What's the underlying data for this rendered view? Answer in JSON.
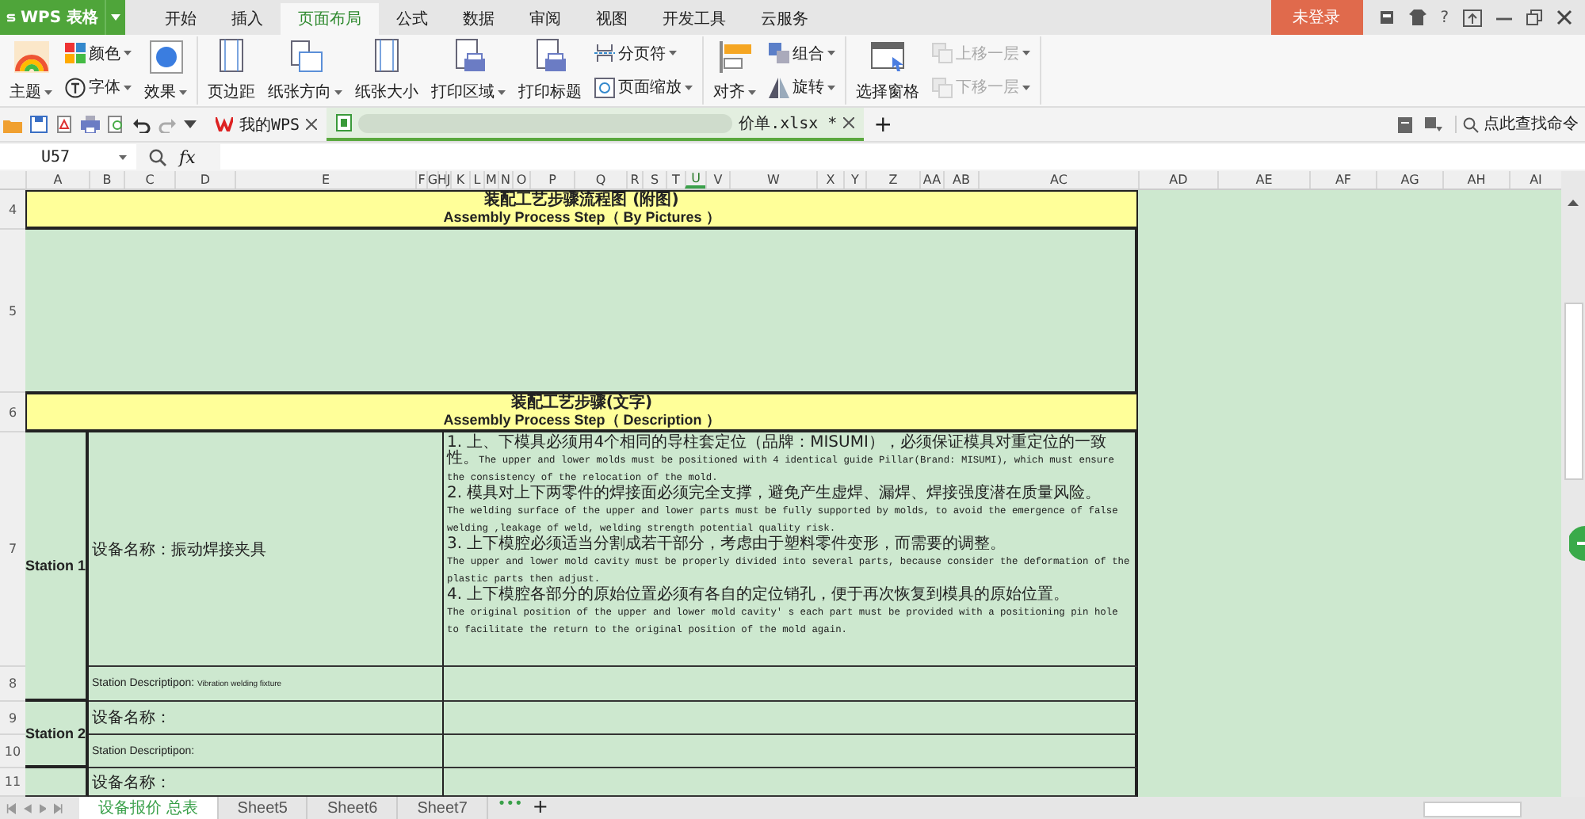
{
  "app": {
    "logo": "WPS 表格"
  },
  "menu_tabs": [
    {
      "label": "开始",
      "selected": false
    },
    {
      "label": "插入",
      "selected": false
    },
    {
      "label": "页面布局",
      "selected": true
    },
    {
      "label": "公式",
      "selected": false
    },
    {
      "label": "数据",
      "selected": false
    },
    {
      "label": "审阅",
      "selected": false
    },
    {
      "label": "视图",
      "selected": false
    },
    {
      "label": "开发工具",
      "selected": false
    },
    {
      "label": "云服务",
      "selected": false
    }
  ],
  "login_button": "未登录",
  "help_button": "?",
  "ribbon": {
    "groups": [
      {
        "columns": [
          {
            "kind": "large",
            "label": "主题",
            "dropdown": true
          },
          {
            "kind": "stack",
            "items": [
              {
                "label": "颜色",
                "dropdown": true,
                "disabled": false
              },
              {
                "label": "字体",
                "dropdown": true,
                "disabled": false
              }
            ]
          },
          {
            "kind": "large",
            "label": "效果",
            "dropdown": true
          }
        ]
      },
      {
        "columns": [
          {
            "kind": "large",
            "label": "页边距",
            "dropdown": false
          },
          {
            "kind": "large",
            "label": "纸张方向",
            "dropdown": true
          },
          {
            "kind": "large",
            "label": "纸张大小",
            "dropdown": false
          },
          {
            "kind": "large",
            "label": "打印区域",
            "dropdown": true
          },
          {
            "kind": "large",
            "label": "打印标题",
            "dropdown": false
          },
          {
            "kind": "stack",
            "items": [
              {
                "label": "分页符",
                "dropdown": true,
                "disabled": false
              },
              {
                "label": "页面缩放",
                "dropdown": true,
                "disabled": false
              }
            ]
          }
        ]
      },
      {
        "columns": [
          {
            "kind": "large",
            "label": "对齐",
            "dropdown": true
          },
          {
            "kind": "stack",
            "items": [
              {
                "label": "组合",
                "dropdown": true,
                "disabled": false
              },
              {
                "label": "旋转",
                "dropdown": true,
                "disabled": false
              }
            ]
          }
        ]
      },
      {
        "columns": [
          {
            "kind": "large",
            "label": "选择窗格",
            "dropdown": false
          },
          {
            "kind": "stack",
            "items": [
              {
                "label": "上移一层",
                "dropdown": true,
                "disabled": true
              },
              {
                "label": "下移一层",
                "dropdown": true,
                "disabled": true
              }
            ]
          }
        ]
      }
    ]
  },
  "doc_tabs": [
    {
      "label": "我的WPS",
      "selected": false
    },
    {
      "label": "价单.xlsx *",
      "selected": true
    }
  ],
  "doc_tab_add": "+",
  "command_search": {
    "placeholder": "点此查找命令"
  },
  "formula_bar": {
    "name_box": "U57",
    "fx": "fx"
  },
  "columns": [
    {
      "label": "A",
      "selected": false
    },
    {
      "label": "B",
      "selected": false
    },
    {
      "label": "C",
      "selected": false
    },
    {
      "label": "D",
      "selected": false
    },
    {
      "label": "E",
      "selected": false
    },
    {
      "label": "F",
      "selected": false
    },
    {
      "label": "G",
      "selected": false
    },
    {
      "label": "H",
      "selected": false
    },
    {
      "label": "J",
      "selected": false
    },
    {
      "label": "K",
      "selected": false
    },
    {
      "label": "L",
      "selected": false
    },
    {
      "label": "M",
      "selected": false
    },
    {
      "label": "N",
      "selected": false
    },
    {
      "label": "O",
      "selected": false
    },
    {
      "label": "P",
      "selected": false
    },
    {
      "label": "Q",
      "selected": false
    },
    {
      "label": "R",
      "selected": false
    },
    {
      "label": "S",
      "selected": false
    },
    {
      "label": "T",
      "selected": false
    },
    {
      "label": "U",
      "selected": true
    },
    {
      "label": "V",
      "selected": false
    },
    {
      "label": "W",
      "selected": false
    },
    {
      "label": "X",
      "selected": false
    },
    {
      "label": "Y",
      "selected": false
    },
    {
      "label": "Z",
      "selected": false
    },
    {
      "label": "AA",
      "selected": false
    },
    {
      "label": "AB",
      "selected": false
    },
    {
      "label": "AC",
      "selected": false
    },
    {
      "label": "AD",
      "selected": false
    },
    {
      "label": "AE",
      "selected": false
    },
    {
      "label": "AF",
      "selected": false
    },
    {
      "label": "AG",
      "selected": false
    },
    {
      "label": "AH",
      "selected": false
    },
    {
      "label": "AI",
      "selected": false
    }
  ],
  "row_numbers": [
    "4",
    "5",
    "6",
    "7",
    "8",
    "9",
    "10",
    "11"
  ],
  "sheet": {
    "pictures_title": {
      "cn": "装配工艺步骤流程图 (附图)",
      "en": "Assembly Process  Step（ By Pictures ）"
    },
    "description_title": {
      "cn": "装配工艺步骤(文字)",
      "en": "Assembly Process  Step（ Description ）"
    },
    "stations": [
      {
        "label": "Station 1",
        "name": "设备名称：振动焊接夹具",
        "description_label": "Station Descriptipon:",
        "description": "Vibration welding fixture",
        "steps": [
          [
            {
              "kind": "cn",
              "text": "1. 上、下模具必须用4个相同的导柱套定位（品牌：MISUMI），必须保证模具对重定位的一致性。"
            },
            {
              "kind": "en",
              "text": "The upper and lower molds must be positioned with 4 identical guide Pillar(Brand: MISUMI), which must ensure the consistency of the relocation of the mold."
            }
          ],
          [
            {
              "kind": "cn",
              "text": "2. 模具对上下两零件的焊接面必须完全支撑，避免产生虚焊、漏焊、焊接强度潜在质量风险。"
            }
          ],
          [
            {
              "kind": "en",
              "text": "The welding surface of the upper and lower parts must be fully supported by molds, to avoid the emergence of false welding ,leakage of weld, welding strength potential quality risk."
            }
          ],
          [
            {
              "kind": "cn",
              "text": "3. 上下模腔必须适当分割成若干部分，考虑由于塑料零件变形，而需要的调整。"
            }
          ],
          [
            {
              "kind": "en",
              "text": "The upper and lower mold cavity must be properly divided into several parts, because consider the deformation of the plastic parts then adjust."
            }
          ],
          [
            {
              "kind": "cn",
              "text": "4. 上下模腔各部分的原始位置必须有各自的定位销孔，便于再次恢复到模具的原始位置。"
            }
          ],
          [
            {
              "kind": "en",
              "text": "The original position of the upper and lower mold cavity' s each part must be provided with a positioning pin hole to facilitate the return to the original position of the mold again."
            }
          ]
        ]
      },
      {
        "label": "Station 2",
        "name": "设备名称：",
        "description_label": "Station Descriptipon:"
      },
      {
        "name": "设备名称："
      }
    ]
  },
  "sheet_tabs": [
    {
      "label": "设备报价 总表",
      "selected": true
    },
    {
      "label": "Sheet5",
      "selected": false
    },
    {
      "label": "Sheet6",
      "selected": false
    },
    {
      "label": "Sheet7",
      "selected": false
    }
  ],
  "sheet_more": "•••",
  "sheet_add": "+"
}
